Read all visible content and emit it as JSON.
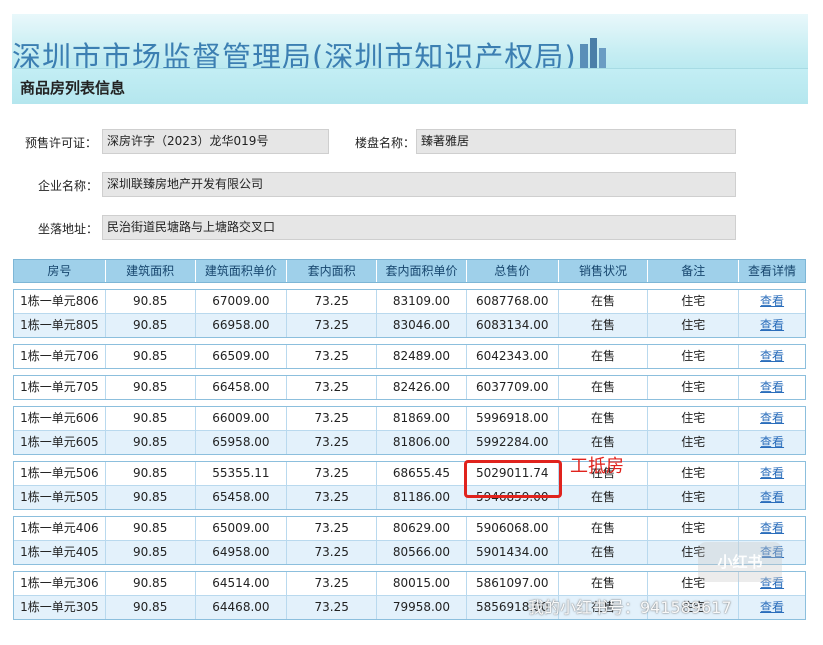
{
  "banner": {
    "org_title": "深圳市市场监督管理局(深圳市知识产权局)",
    "section_title": "商品房列表信息"
  },
  "form": {
    "presale_label": "预售许可证：",
    "presale_value": "深房许字（2023）龙华019号",
    "project_label": "楼盘名称：",
    "project_value": "臻著雅居",
    "company_label": "企业名称：",
    "company_value": "深圳联臻房地产开发有限公司",
    "address_label": "坐落地址：",
    "address_value": "民治街道民塘路与上塘路交叉口"
  },
  "table": {
    "headers": [
      "房号",
      "建筑面积",
      "建筑面积单价",
      "套内面积",
      "套内面积单价",
      "总售价",
      "销售状况",
      "备注",
      "查看详情"
    ],
    "groups": [
      [
        [
          "1栋一单元806",
          "90.85",
          "67009.00",
          "73.25",
          "83109.00",
          "6087768.00",
          "在售",
          "住宅",
          "查看"
        ],
        [
          "1栋一单元805",
          "90.85",
          "66958.00",
          "73.25",
          "83046.00",
          "6083134.00",
          "在售",
          "住宅",
          "查看"
        ]
      ],
      [
        [
          "1栋一单元706",
          "90.85",
          "66509.00",
          "73.25",
          "82489.00",
          "6042343.00",
          "在售",
          "住宅",
          "查看"
        ]
      ],
      [
        [
          "1栋一单元705",
          "90.85",
          "66458.00",
          "73.25",
          "82426.00",
          "6037709.00",
          "在售",
          "住宅",
          "查看"
        ]
      ],
      [
        [
          "1栋一单元606",
          "90.85",
          "66009.00",
          "73.25",
          "81869.00",
          "5996918.00",
          "在售",
          "住宅",
          "查看"
        ],
        [
          "1栋一单元605",
          "90.85",
          "65958.00",
          "73.25",
          "81806.00",
          "5992284.00",
          "在售",
          "住宅",
          "查看"
        ]
      ],
      [
        [
          "1栋一单元506",
          "90.85",
          "55355.11",
          "73.25",
          "68655.45",
          "5029011.74",
          "在售",
          "住宅",
          "查看"
        ],
        [
          "1栋一单元505",
          "90.85",
          "65458.00",
          "73.25",
          "81186.00",
          "5946859.00",
          "在售",
          "住宅",
          "查看"
        ]
      ],
      [
        [
          "1栋一单元406",
          "90.85",
          "65009.00",
          "73.25",
          "80629.00",
          "5906068.00",
          "在售",
          "住宅",
          "查看"
        ],
        [
          "1栋一单元405",
          "90.85",
          "64958.00",
          "73.25",
          "80566.00",
          "5901434.00",
          "在售",
          "住宅",
          "查看"
        ]
      ],
      [
        [
          "1栋一单元306",
          "90.85",
          "64514.00",
          "73.25",
          "80015.00",
          "5861097.00",
          "在售",
          "住宅",
          "查看"
        ],
        [
          "1栋一单元305",
          "90.85",
          "64468.00",
          "73.25",
          "79958.00",
          "5856918.00",
          "在售",
          "住宅",
          "查看"
        ]
      ]
    ]
  },
  "annotation": {
    "label": "工抵房",
    "color": "#e0231d"
  },
  "watermark": {
    "logo": "小红书",
    "text": "我的小红书号：941589617"
  },
  "colors": {
    "header_bg": "#9fd0ea",
    "row_alt": "#e3f1fb",
    "link": "#2a6dbb"
  }
}
